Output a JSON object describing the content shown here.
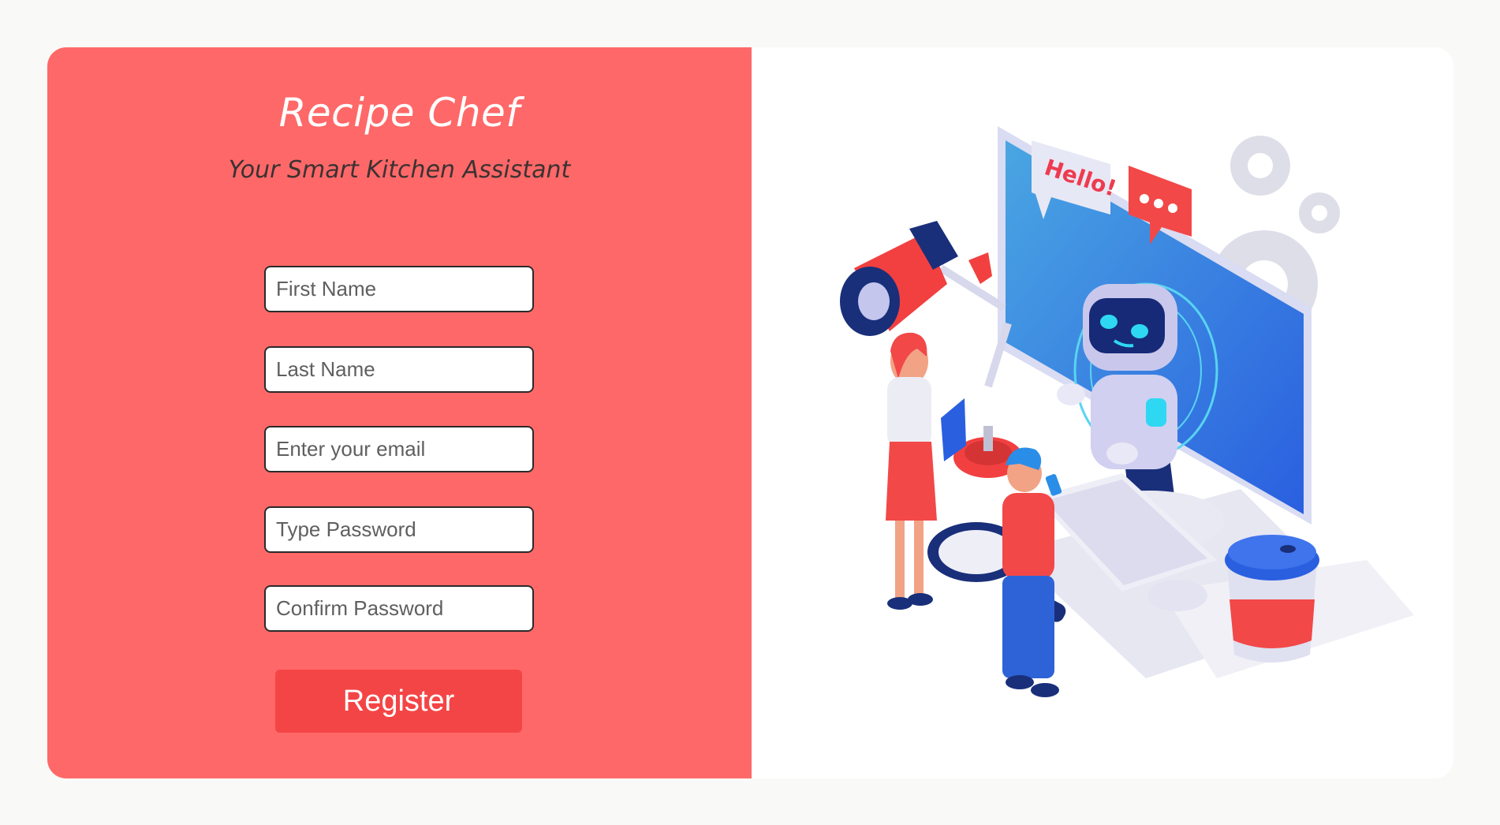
{
  "app": {
    "title": "Recipe Chef",
    "subtitle": "Your Smart Kitchen Assistant"
  },
  "form": {
    "first_name": {
      "placeholder": "First Name",
      "value": ""
    },
    "last_name": {
      "placeholder": "Last Name",
      "value": ""
    },
    "email": {
      "placeholder": "Enter your email",
      "value": ""
    },
    "password": {
      "placeholder": "Type Password",
      "value": ""
    },
    "confirm_password": {
      "placeholder": "Confirm Password",
      "value": ""
    },
    "register_label": "Register"
  },
  "illustration": {
    "speech_bubble_text": "Hello!",
    "icon": "robot-assistant-illustration"
  },
  "colors": {
    "panel": "#ff6868",
    "button": "#f44546",
    "page_bg": "#f9f9f7"
  }
}
